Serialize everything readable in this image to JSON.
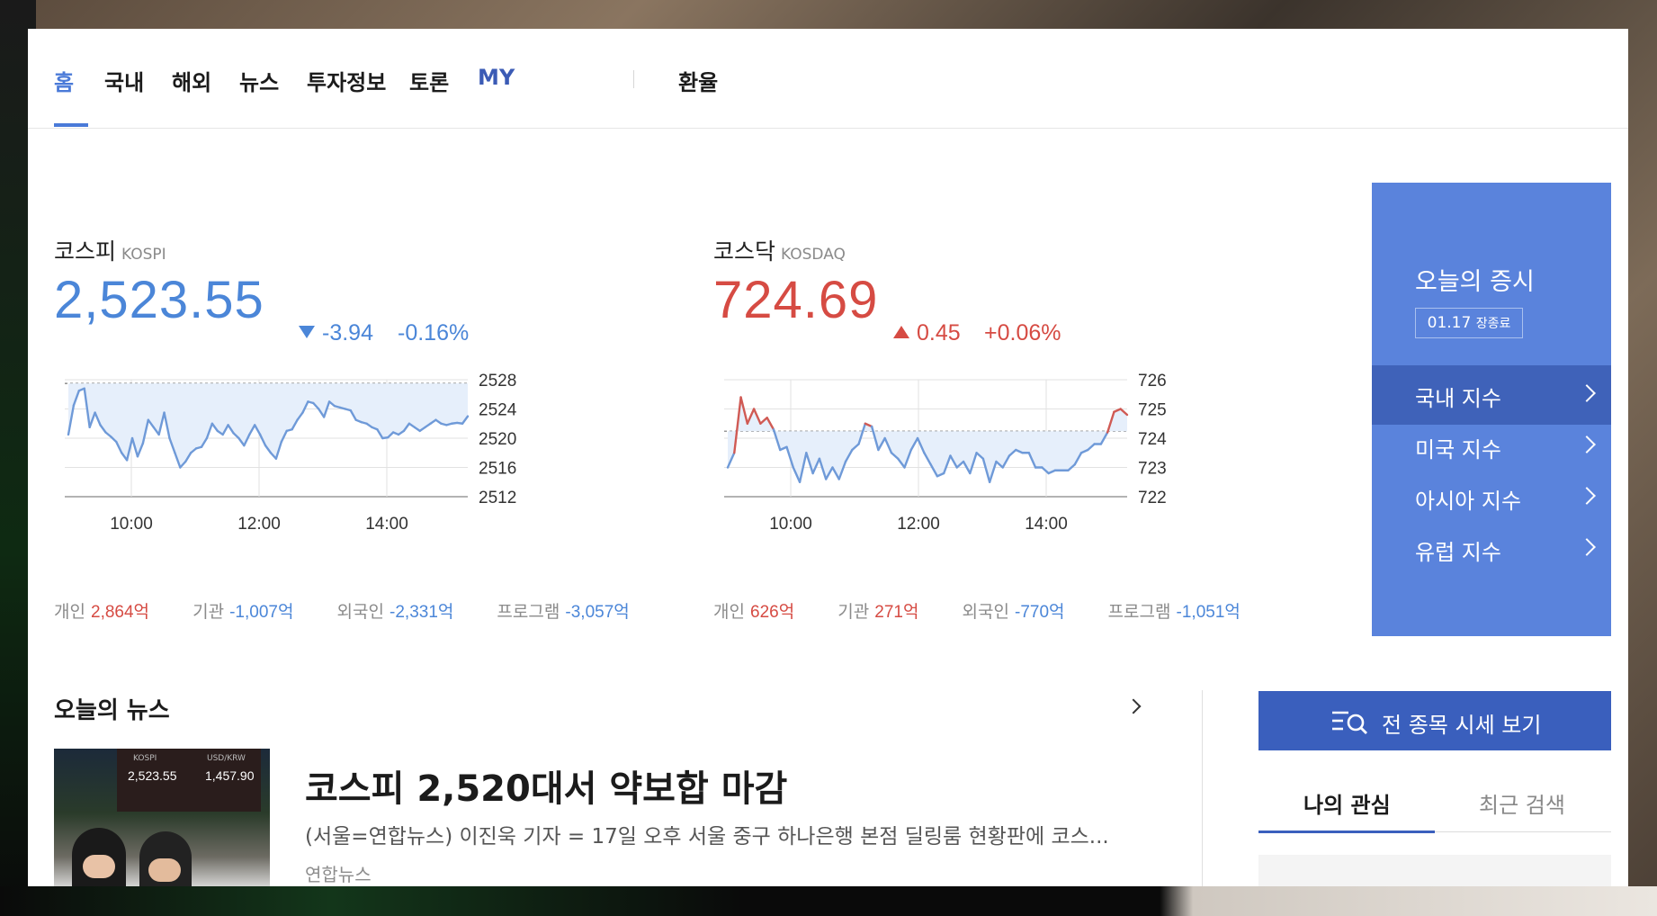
{
  "nav": {
    "items": [
      "홈",
      "국내",
      "해외",
      "뉴스",
      "투자정보",
      "토론",
      "MY"
    ],
    "extra": "환율"
  },
  "kospi": {
    "name": "코스피",
    "sub": "KOSPI",
    "value": "2,523.55",
    "change": "-3.94",
    "rate": "-0.16%",
    "direction": "down",
    "y_ticks": [
      "2528",
      "2524",
      "2520",
      "2516",
      "2512"
    ],
    "x_ticks": [
      "10:00",
      "12:00",
      "14:00"
    ],
    "investors": [
      {
        "label": "개인",
        "value": "2,864억",
        "sign": "up"
      },
      {
        "label": "기관",
        "value": "-1,007억",
        "sign": "down"
      },
      {
        "label": "외국인",
        "value": "-2,331억",
        "sign": "down"
      },
      {
        "label": "프로그램",
        "value": "-3,057억",
        "sign": "down"
      }
    ]
  },
  "kosdaq": {
    "name": "코스닥",
    "sub": "KOSDAQ",
    "value": "724.69",
    "change": "0.45",
    "rate": "+0.06%",
    "direction": "up",
    "y_ticks": [
      "726",
      "725",
      "724",
      "723",
      "722"
    ],
    "x_ticks": [
      "10:00",
      "12:00",
      "14:00"
    ],
    "investors": [
      {
        "label": "개인",
        "value": "626억",
        "sign": "up"
      },
      {
        "label": "기관",
        "value": "271억",
        "sign": "up"
      },
      {
        "label": "외국인",
        "value": "-770억",
        "sign": "down"
      },
      {
        "label": "프로그램",
        "value": "-1,051억",
        "sign": "down"
      }
    ]
  },
  "panel": {
    "title": "오늘의 증시",
    "date": "01.17",
    "status": "장종료",
    "items": [
      "국내 지수",
      "미국 지수",
      "아시아 지수",
      "유럽 지수"
    ]
  },
  "news": {
    "section_title": "오늘의 뉴스",
    "headline": "코스피 2,520대서 약보합 마감",
    "summary": "(서울=연합뉴스) 이진욱 기자 = 17일 오후 서울 중구 하나은행 본점 딜링룸 현황판에 코스...",
    "source": "연합뉴스",
    "thumb": {
      "kospi_label": "KOSPI",
      "kospi_value": "2,523.55",
      "usdkrw_label": "USD/KRW",
      "usdkrw_value": "1,457.90"
    }
  },
  "sidebar": {
    "all_button": "전 종목 시세 보기",
    "tabs": [
      "나의 관심",
      "최근 검색"
    ]
  },
  "chart_data": [
    {
      "type": "line",
      "title": "코스피 KOSPI",
      "x_ticks": [
        "10:00",
        "12:00",
        "14:00"
      ],
      "ylim": [
        2512,
        2528
      ],
      "prev_close": 2527.49,
      "values": [
        2520.5,
        2524.5,
        2526.5,
        2526.8,
        2521.5,
        2523.5,
        2521.8,
        2520.8,
        2520.2,
        2519.5,
        2518.0,
        2517.0,
        2520.0,
        2517.5,
        2519.3,
        2522.5,
        2521.5,
        2520.5,
        2523.5,
        2520.0,
        2518.0,
        2516.0,
        2516.8,
        2518.0,
        2518.6,
        2518.8,
        2520.0,
        2522.0,
        2521.0,
        2520.5,
        2521.8,
        2520.7,
        2520.0,
        2519.0,
        2520.5,
        2521.8,
        2520.5,
        2519.0,
        2518.0,
        2517.2,
        2519.5,
        2521.0,
        2521.2,
        2522.5,
        2523.5,
        2525.0,
        2524.8,
        2524.0,
        2522.9,
        2525.0,
        2524.4,
        2524.2,
        2524.0,
        2523.8,
        2522.5,
        2522.2,
        2522.0,
        2521.5,
        2521.2,
        2520.0,
        2520.1,
        2520.8,
        2520.5,
        2521.0,
        2522.0,
        2521.5,
        2521.0,
        2521.5,
        2522.0,
        2522.5,
        2522.0,
        2521.8,
        2522.0,
        2522.1,
        2522.0,
        2523.0
      ]
    },
    {
      "type": "line",
      "title": "코스닥 KOSDAQ",
      "x_ticks": [
        "10:00",
        "12:00",
        "14:00"
      ],
      "ylim": [
        722,
        726
      ],
      "prev_close": 724.24,
      "values": [
        723.0,
        723.5,
        725.4,
        724.5,
        725.0,
        724.5,
        724.7,
        724.3,
        723.6,
        723.7,
        723.0,
        722.5,
        723.5,
        722.8,
        723.3,
        722.6,
        723.0,
        722.6,
        723.2,
        723.6,
        723.8,
        724.5,
        724.4,
        723.6,
        724.0,
        723.5,
        723.3,
        723.0,
        723.6,
        724.0,
        723.5,
        723.1,
        722.7,
        722.8,
        723.4,
        723.0,
        723.2,
        722.8,
        723.5,
        723.3,
        722.5,
        723.2,
        723.0,
        723.4,
        723.6,
        723.5,
        723.5,
        723.0,
        723.0,
        722.8,
        722.9,
        722.9,
        722.9,
        723.1,
        723.5,
        723.6,
        723.8,
        723.8,
        724.2,
        724.9,
        725.0,
        724.8
      ]
    }
  ]
}
